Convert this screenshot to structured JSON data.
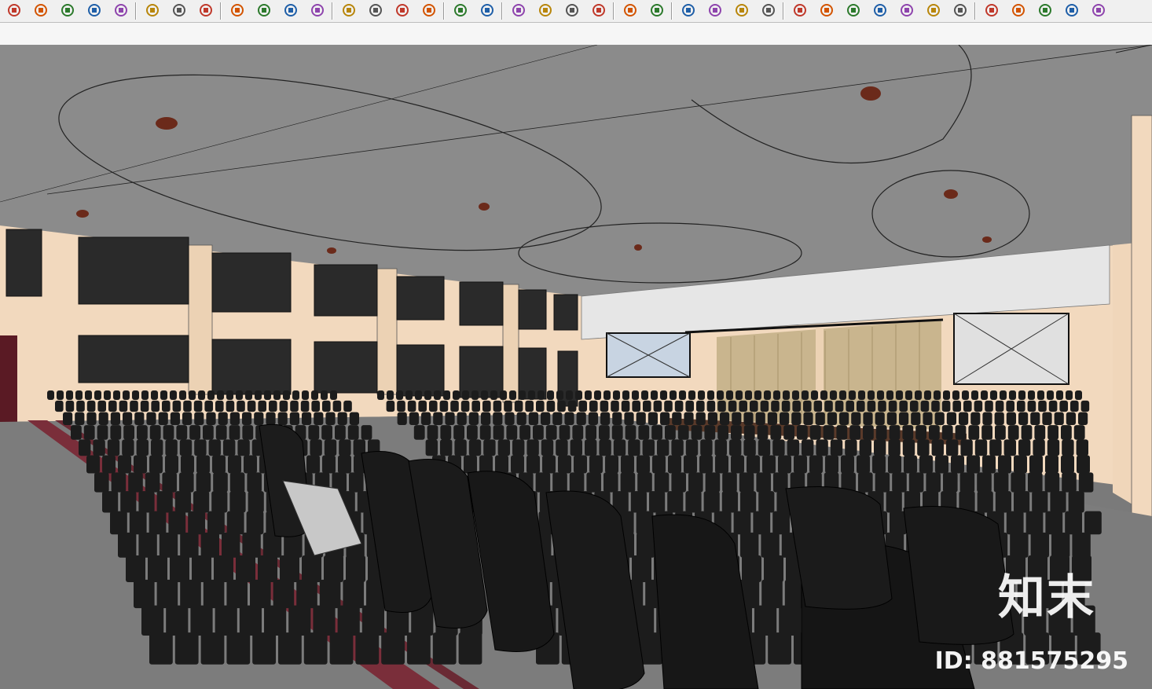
{
  "toolbar": {
    "buttons": [
      "place-component-icon",
      "paint-bucket-icon",
      "move-icon",
      "rotate-icon",
      "scale-icon",
      "tape-measure-icon",
      "text-label-icon",
      "paint-icon",
      "orbit-icon",
      "pan-icon",
      "zoom-icon",
      "zoom-extents-icon",
      "warehouse-icon",
      "extension-icon",
      "share-model-icon",
      "ruby-icon",
      "user-account-icon",
      "dropdown-arrow-icon",
      "vray-logo-icon",
      "teapot-render-icon",
      "interactive-render-icon",
      "cloud-render-icon",
      "frame-buffer-icon",
      "material-editor-icon",
      "window-light-icon",
      "camera-icon",
      "batch-render-icon",
      "lock-icon",
      "omni-light-icon",
      "sphere-light-icon",
      "spot-light-icon",
      "ies-light-icon",
      "sun-light-icon",
      "dome-light-icon",
      "mesh-light-icon",
      "infinite-plane-icon",
      "proxy-export-icon",
      "proxy-import-icon",
      "fur-icon",
      "clipper-icon"
    ]
  },
  "viewport": {
    "scene": "auditorium-3d-model",
    "colors": {
      "ceiling": "#8a8a8a",
      "wall": "#f2d9be",
      "floor": "#7c7c7c",
      "aisle": "#7a2e3a",
      "seat": "#1c1c1c",
      "curtain": "#c8b48c",
      "stage": "#5a3a2a"
    }
  },
  "watermark": {
    "brand": "知末",
    "id_text": "ID: 881575295"
  }
}
